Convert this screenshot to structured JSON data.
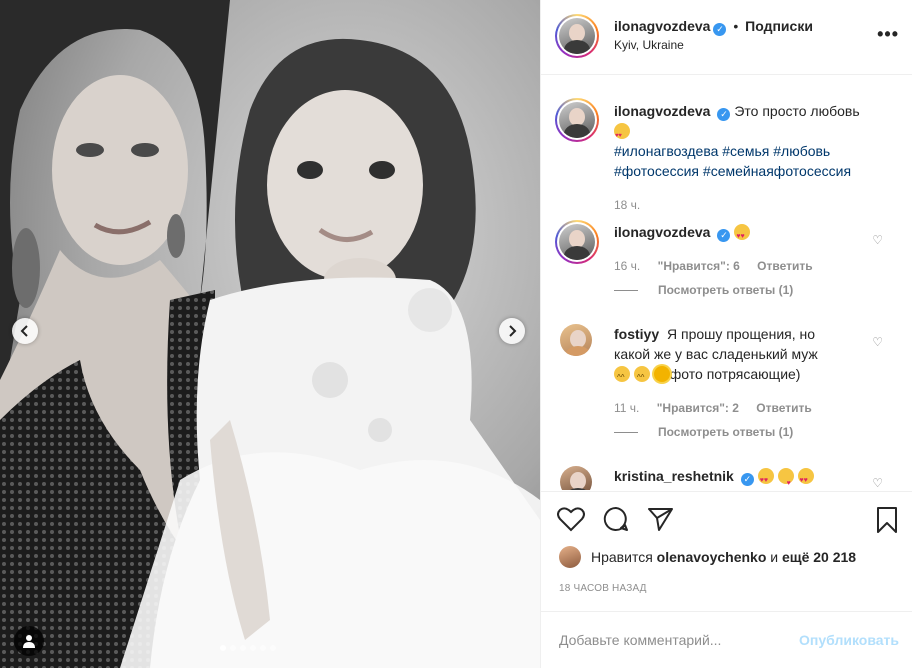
{
  "post": {
    "author": "ilonagvozdeva",
    "location": "Kyiv, Ukraine",
    "separator": "•",
    "follow_label": "Подписки",
    "more_label": "•••",
    "carousel": {
      "slide_count": 6,
      "active_index": 0
    }
  },
  "caption": {
    "user": "ilonagvozdeva",
    "text": "Это просто любовь",
    "hashtags_line1": "#илонагвоздева #семья #любовь",
    "hashtags_line2": "#фотосессия #семейнаяфотосессия",
    "time": "18 ч."
  },
  "comments": [
    {
      "user": "ilonagvozdeva",
      "text": "",
      "time": "16 ч.",
      "likes": "\"Нравится\": 6",
      "reply_label": "Ответить",
      "view_replies": "Посмотреть ответы (1)"
    },
    {
      "user": "fostiyy",
      "text_line1": "Я прошу прощения, но",
      "text_line2": "какой же у вас сладенький муж",
      "text_line3": "фото потрясающие)",
      "time": "11 ч.",
      "likes": "\"Нравится\": 2",
      "reply_label": "Ответить",
      "view_replies": "Посмотреть ответы (1)"
    },
    {
      "user": "kristina_reshetnik",
      "text": ""
    }
  ],
  "likes": {
    "prefix": "Нравится",
    "user": "olenavoychenko",
    "middle": "и",
    "rest": "ещё 20 218"
  },
  "time_ago": "18 ЧАСОВ НАЗАД",
  "add_comment": {
    "placeholder": "Добавьте комментарий...",
    "publish_label": "Опубликовать"
  },
  "colors": {
    "accent_blue": "#3897f0",
    "hashtag": "#00376b",
    "muted": "#8e8e8e",
    "publish_disabled": "#b2dffc"
  },
  "icons": [
    "heart-icon",
    "comment-icon",
    "share-icon",
    "bookmark-icon",
    "chevron-left-icon",
    "chevron-right-icon",
    "user-tag-icon",
    "verified-icon"
  ]
}
